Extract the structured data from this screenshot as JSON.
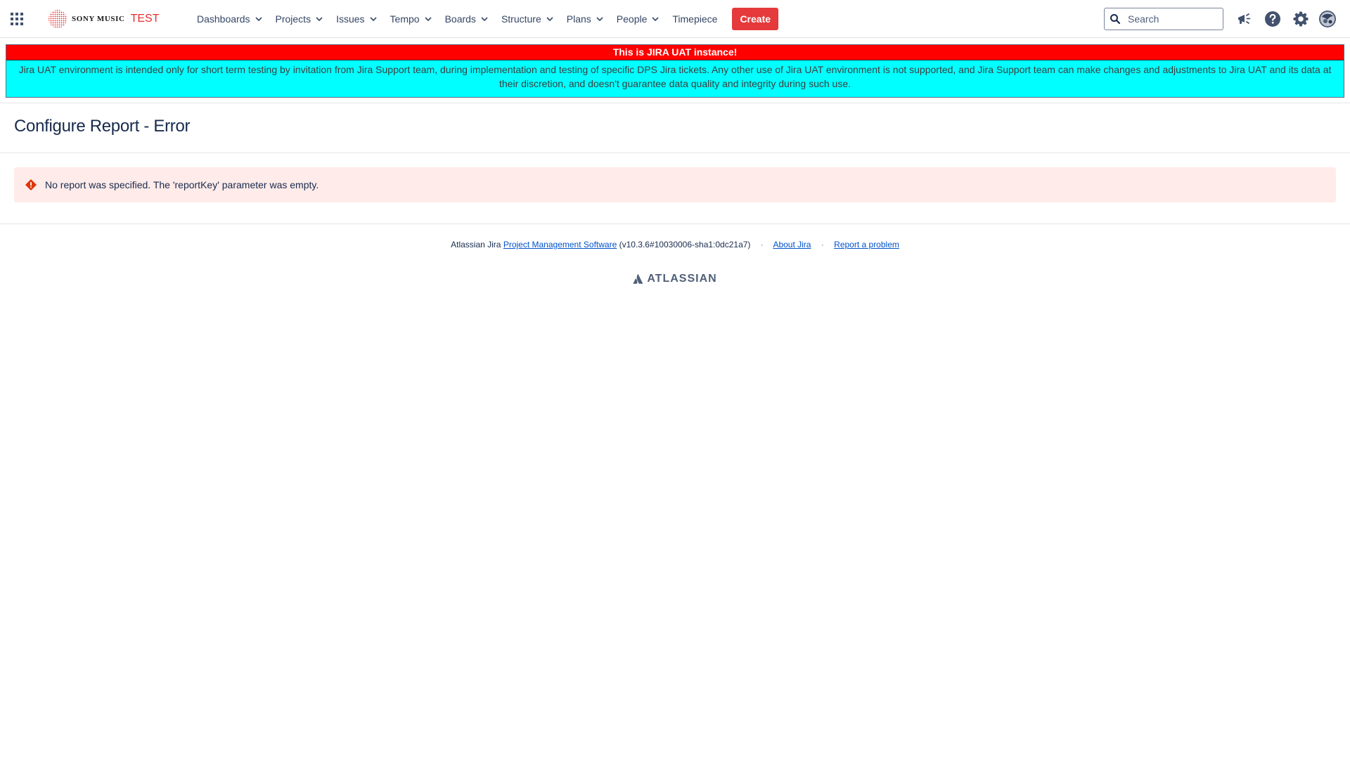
{
  "header": {
    "logo_text": "SONY MUSIC",
    "logo_suffix": "TEST",
    "nav": [
      {
        "label": "Dashboards",
        "has_dropdown": true
      },
      {
        "label": "Projects",
        "has_dropdown": true
      },
      {
        "label": "Issues",
        "has_dropdown": true
      },
      {
        "label": "Tempo",
        "has_dropdown": true
      },
      {
        "label": "Boards",
        "has_dropdown": true
      },
      {
        "label": "Structure",
        "has_dropdown": true
      },
      {
        "label": "Plans",
        "has_dropdown": true
      },
      {
        "label": "People",
        "has_dropdown": true
      },
      {
        "label": "Timepiece",
        "has_dropdown": false
      }
    ],
    "create_label": "Create",
    "search_placeholder": "Search",
    "icons": [
      "app-switcher-icon",
      "announcement-icon",
      "help-icon",
      "settings-icon",
      "avatar"
    ]
  },
  "banner": {
    "title": "This is JIRA UAT instance!",
    "body": "Jira UAT environment is intended only for short term testing by invitation from Jira Support team, during implementation and testing of specific DPS Jira tickets. Any other use of Jira UAT environment is not supported, and Jira Support team can make changes and adjustments to Jira UAT and its data at their discretion, and doesn't guarantee data quality and integrity during such use.",
    "title_color": "#ff0000",
    "body_color": "#00ffff"
  },
  "page": {
    "title": "Configure Report - Error"
  },
  "error": {
    "message": "No report was specified. The 'reportKey' parameter was empty.",
    "icon": "error-icon",
    "background_color": "#ffebe9"
  },
  "footer": {
    "prefix": "Atlassian Jira",
    "link_pms": "Project Management Software",
    "version": "(v10.3.6#10030006-sha1:0dc21a7)",
    "separator": "·",
    "link_about": "About Jira",
    "link_report": "Report a problem",
    "logo_text": "ATLASSIAN"
  },
  "colors": {
    "create_button": "#e5393b",
    "link": "#0052cc",
    "logo_accent": "#e62e2e"
  }
}
